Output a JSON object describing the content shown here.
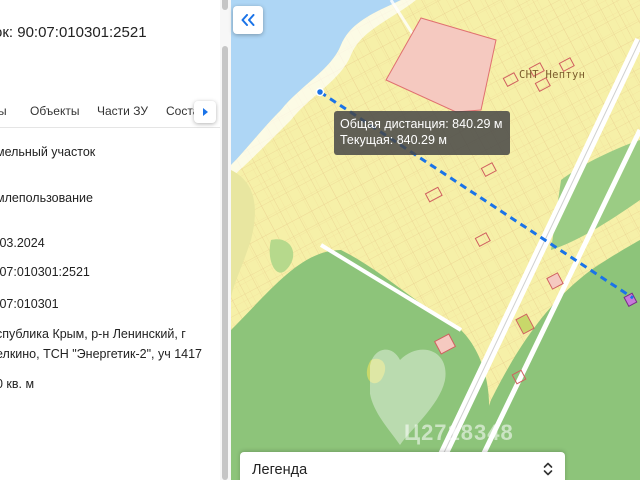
{
  "panel": {
    "title": "ок: 90:07:010301:2521",
    "tabs": [
      {
        "label": "ы"
      },
      {
        "label": "Объекты"
      },
      {
        "label": "Части ЗУ"
      },
      {
        "label": "Соста"
      }
    ],
    "fields": [
      {
        "value": "мельный участок"
      },
      {
        "value": "млепользование"
      },
      {
        "value": ".03.2024"
      },
      {
        "value": ":07:010301:2521"
      },
      {
        "value": ":07:010301"
      },
      {
        "value": "спублика Крым, р-н Ленинский, г"
      },
      {
        "value": "елкино, ТСН \"Энергетик-2\", уч 1417"
      },
      {
        "value": "0 кв. м"
      }
    ]
  },
  "map": {
    "tooltip": {
      "total": "Общая дистанция: 840.29 м",
      "current": "Текущая: 840.29 м"
    },
    "snt_label": "СНТ Нептун",
    "legend": {
      "label": "Легенда"
    },
    "colors": {
      "water": "#aed6f5",
      "land": "#f6f0a8",
      "greenery": "#8dc47a",
      "parcel_outline": "#e0a070",
      "highlight": "#f5c9c0",
      "measure_line": "#1a73e8",
      "road": "#ffffff"
    },
    "icons": [
      "collapse-double-chevron-left-icon",
      "chevron-right-icon",
      "sort-arrows-icon"
    ]
  }
}
